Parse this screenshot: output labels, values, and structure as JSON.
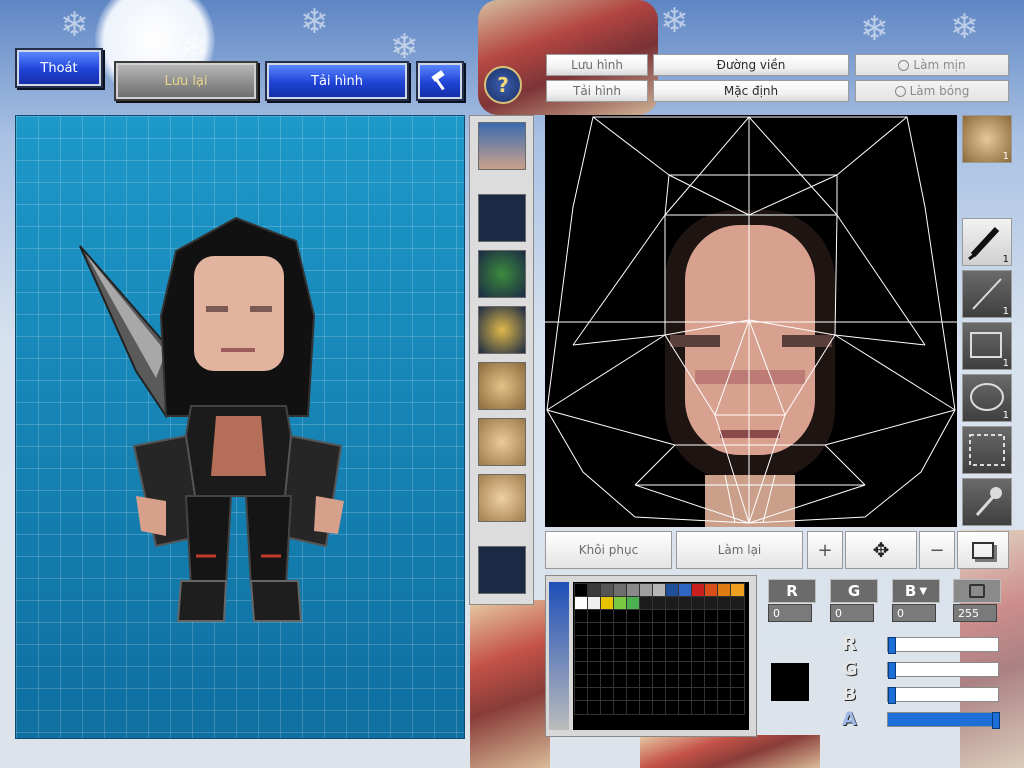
{
  "toolbar": {
    "exit_label": "Thoát",
    "save_label": "Lưu lại",
    "reload_label": "Tải hình"
  },
  "editor_tabs": {
    "save_image": "Lưu hình",
    "load_image": "Tải hình",
    "outline": "Đường viền",
    "default": "Mặc định",
    "smooth": "Làm mịn",
    "shade": "Làm bóng"
  },
  "tools": {
    "pen_count": "1",
    "line_count": "1",
    "rect_count": "1",
    "ellipse_count": "1",
    "face_count": "1"
  },
  "actions": {
    "restore": "Khôi phục",
    "redo": "Làm lại"
  },
  "color": {
    "r_label": "R",
    "g_label": "G",
    "b_label": "B",
    "r_value": "0",
    "g_value": "0",
    "b_value": "0",
    "a_value": "255",
    "current_hex": "#000000",
    "palette_row1": [
      "#000000",
      "#3a3a3a",
      "#555555",
      "#6e6e6e",
      "#8a8a8a",
      "#a0a0a0",
      "#b7b7b7",
      "#1f4f99",
      "#2f66c4",
      "#c81e1e",
      "#d94f1c",
      "#e07b12",
      "#f0a020"
    ],
    "palette_row2": [
      "#ffffff",
      "#f0f0f0",
      "#e8c400",
      "#7ac943",
      "#4caf50",
      "#1c1c1c",
      "#1c1c1c",
      "#1c1c1c",
      "#1c1c1c",
      "#1c1c1c",
      "#1c1c1c",
      "#1c1c1c",
      "#1c1c1c"
    ],
    "r_level": 0.0,
    "g_level": 0.0,
    "b_level": 0.0,
    "a_level": 1.0
  }
}
